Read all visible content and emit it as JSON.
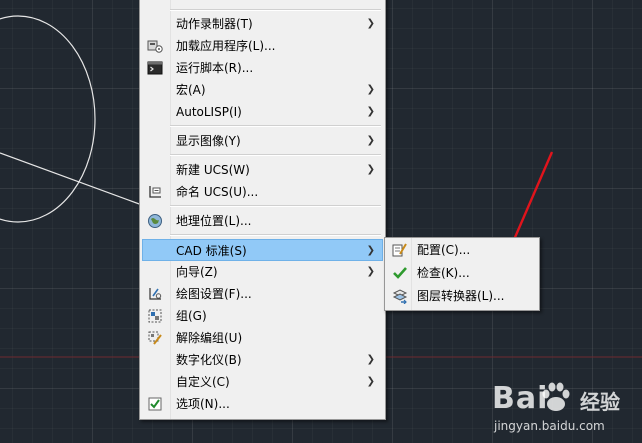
{
  "main_menu": {
    "partial_top_item": "...",
    "items": [
      {
        "label": "动作录制器(T)",
        "submenu": true,
        "icon": null
      },
      {
        "label": "加载应用程序(L)...",
        "submenu": false,
        "icon": "load-application-icon"
      },
      {
        "label": "运行脚本(R)...",
        "submenu": false,
        "icon": "run-script-icon"
      },
      {
        "label": "宏(A)",
        "submenu": true,
        "icon": null
      },
      {
        "label": "AutoLISP(I)",
        "submenu": true,
        "icon": null
      },
      {
        "label": "显示图像(Y)",
        "submenu": true,
        "icon": null
      },
      {
        "label": "新建 UCS(W)",
        "submenu": true,
        "icon": null
      },
      {
        "label": "命名 UCS(U)...",
        "submenu": false,
        "icon": "named-ucs-icon"
      },
      {
        "label": "地理位置(L)...",
        "submenu": false,
        "icon": "geolocation-icon"
      },
      {
        "label": "CAD 标准(S)",
        "submenu": true,
        "icon": null,
        "active": true
      },
      {
        "label": "向导(Z)",
        "submenu": true,
        "icon": null
      },
      {
        "label": "绘图设置(F)...",
        "submenu": false,
        "icon": "drafting-settings-icon"
      },
      {
        "label": "组(G)",
        "submenu": false,
        "icon": "group-icon"
      },
      {
        "label": "解除编组(U)",
        "submenu": false,
        "icon": "ungroup-icon"
      },
      {
        "label": "数字化仪(B)",
        "submenu": true,
        "icon": null
      },
      {
        "label": "自定义(C)",
        "submenu": true,
        "icon": null
      },
      {
        "label": "选项(N)...",
        "submenu": false,
        "icon": "options-checkbox-icon"
      }
    ]
  },
  "sub_menu": {
    "items": [
      {
        "label": "配置(C)...",
        "icon": "configure-standards-icon"
      },
      {
        "label": "检查(K)...",
        "icon": "check-standards-icon"
      },
      {
        "label": "图层转换器(L)...",
        "icon": "layer-translator-icon"
      }
    ]
  },
  "watermark": {
    "brand_left": "Bai",
    "brand_right": "经验",
    "url": "jingyan.baidu.com"
  },
  "colors": {
    "canvas": "#212830",
    "menu_bg": "#f0f0f0",
    "highlight": "#91c9f7",
    "annotation_arrow": "#e0141c",
    "crosshair_red": "#7a2a30"
  }
}
